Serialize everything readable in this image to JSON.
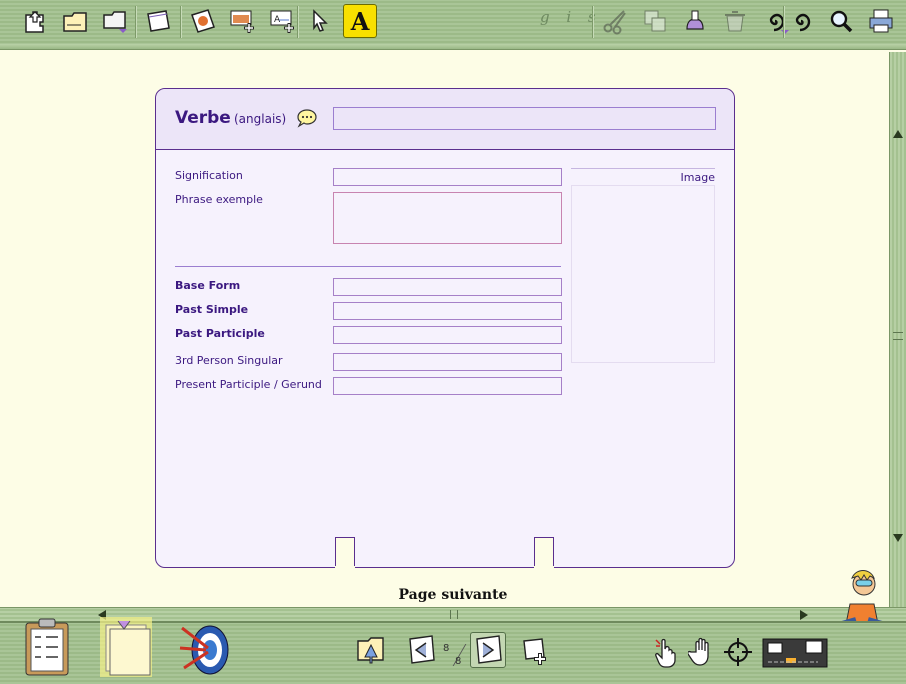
{
  "toolbar": {
    "tools": [
      {
        "name": "home-tool",
        "icon": "puzzle-arrow-icon"
      },
      {
        "name": "folder-tool",
        "icon": "folder-icon"
      },
      {
        "name": "folder-menu-tool",
        "icon": "folder-menu-icon"
      },
      {
        "name": "card-tool",
        "icon": "blank-card-icon"
      },
      {
        "name": "picture-card-tool",
        "icon": "picture-card-icon"
      },
      {
        "name": "add-picture-field-tool",
        "icon": "add-picture-field-icon"
      },
      {
        "name": "add-text-field-tool",
        "icon": "add-text-field-icon"
      },
      {
        "name": "pointer-tool",
        "icon": "arrow-pointer-icon"
      },
      {
        "name": "text-tool",
        "icon": "letter-a-icon"
      },
      {
        "name": "scissors-tool",
        "icon": "scissors-icon"
      },
      {
        "name": "copy-tool",
        "icon": "copy-icon"
      },
      {
        "name": "glue-tool",
        "icon": "glue-icon"
      },
      {
        "name": "trash-tool",
        "icon": "trash-icon"
      },
      {
        "name": "spiral-menu-tool",
        "icon": "spiral-icon"
      },
      {
        "name": "spiral-tool",
        "icon": "spiral-icon"
      },
      {
        "name": "search-tool",
        "icon": "magnifier-icon"
      },
      {
        "name": "print-tool",
        "icon": "printer-icon"
      }
    ],
    "text_tool_label": "A",
    "gis_label": "g i s"
  },
  "card": {
    "title": "Verbe",
    "language": "(anglais)",
    "title_value": "",
    "fields": [
      {
        "label": "Signification",
        "value": "",
        "bold": false
      },
      {
        "label": "Phrase exemple",
        "value": "",
        "bold": false
      },
      {
        "label": "Base Form",
        "value": "",
        "bold": true
      },
      {
        "label": "Past Simple",
        "value": "",
        "bold": true
      },
      {
        "label": "Past Participle",
        "value": "",
        "bold": true
      },
      {
        "label": "3rd Person Singular",
        "value": "",
        "bold": false
      },
      {
        "label": "Present Participle / Gerund",
        "value": "",
        "bold": false
      }
    ],
    "image_label": "Image"
  },
  "footer": {
    "next_page": "Page suivante",
    "current_page": "8",
    "total_pages": "8"
  },
  "colors": {
    "accent": "#3b1880",
    "card_border": "#5a2e8e",
    "toolbar": "#a9c597",
    "background": "#fdfde6",
    "active_tool": "#f8e000"
  }
}
